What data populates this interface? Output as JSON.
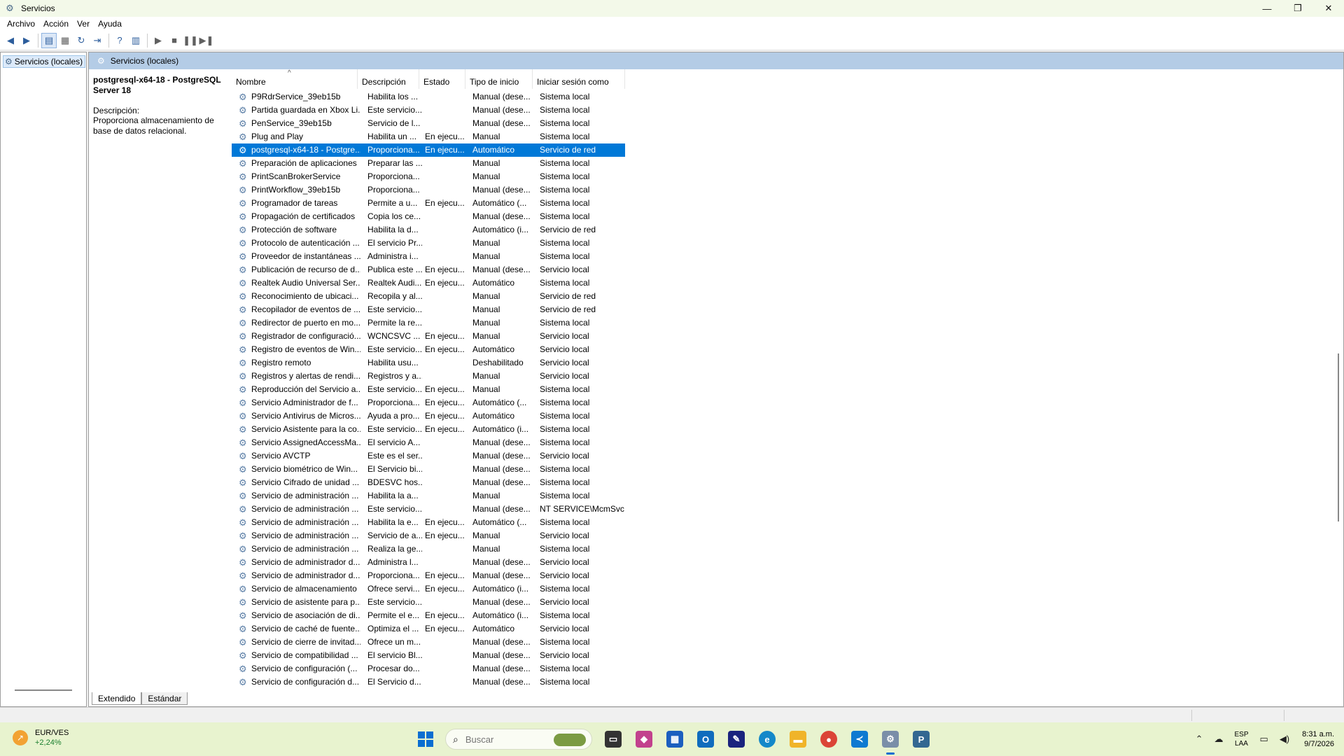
{
  "window": {
    "title": "Servicios",
    "minimize_icon": "—",
    "maximize_icon": "❐",
    "close_icon": "✕"
  },
  "menu": [
    "Archivo",
    "Acción",
    "Ver",
    "Ayuda"
  ],
  "tree": {
    "item": "Servicios (locales)"
  },
  "header": {
    "title": "Servicios (locales)"
  },
  "details": {
    "title": "postgresql-x64-18 - PostgreSQL Server 18",
    "label": "Descripción:",
    "text": "Proporciona almacenamiento de base de datos relacional."
  },
  "columns": {
    "name": "Nombre",
    "desc": "Descripción",
    "state": "Estado",
    "start": "Tipo de inicio",
    "logon": "Iniciar sesión como"
  },
  "rows": [
    {
      "name": "P9RdrService_39eb15b",
      "desc": "Habilita los ...",
      "state": "",
      "start": "Manual (dese...",
      "logon": "Sistema local"
    },
    {
      "name": "Partida guardada en Xbox Li...",
      "desc": "Este servicio...",
      "state": "",
      "start": "Manual (dese...",
      "logon": "Sistema local"
    },
    {
      "name": "PenService_39eb15b",
      "desc": "Servicio de l...",
      "state": "",
      "start": "Manual (dese...",
      "logon": "Sistema local"
    },
    {
      "name": "Plug and Play",
      "desc": "Habilita un ...",
      "state": "En ejecu...",
      "start": "Manual",
      "logon": "Sistema local"
    },
    {
      "name": "postgresql-x64-18 - Postgre...",
      "desc": "Proporciona...",
      "state": "En ejecu...",
      "start": "Automático",
      "logon": "Servicio de red",
      "selected": true
    },
    {
      "name": "Preparación de aplicaciones",
      "desc": "Preparar las ...",
      "state": "",
      "start": "Manual",
      "logon": "Sistema local"
    },
    {
      "name": "PrintScanBrokerService",
      "desc": "Proporciona...",
      "state": "",
      "start": "Manual",
      "logon": "Sistema local"
    },
    {
      "name": "PrintWorkflow_39eb15b",
      "desc": "Proporciona...",
      "state": "",
      "start": "Manual (dese...",
      "logon": "Sistema local"
    },
    {
      "name": "Programador de tareas",
      "desc": "Permite a u...",
      "state": "En ejecu...",
      "start": "Automático (...",
      "logon": "Sistema local"
    },
    {
      "name": "Propagación de certificados",
      "desc": "Copia los ce...",
      "state": "",
      "start": "Manual (dese...",
      "logon": "Sistema local"
    },
    {
      "name": "Protección de software",
      "desc": "Habilita la d...",
      "state": "",
      "start": "Automático (i...",
      "logon": "Servicio de red"
    },
    {
      "name": "Protocolo de autenticación ...",
      "desc": "El servicio Pr...",
      "state": "",
      "start": "Manual",
      "logon": "Sistema local"
    },
    {
      "name": "Proveedor de instantáneas ...",
      "desc": "Administra i...",
      "state": "",
      "start": "Manual",
      "logon": "Sistema local"
    },
    {
      "name": "Publicación de recurso de d...",
      "desc": "Publica este ...",
      "state": "En ejecu...",
      "start": "Manual (dese...",
      "logon": "Servicio local"
    },
    {
      "name": "Realtek Audio Universal Ser...",
      "desc": "Realtek Audi...",
      "state": "En ejecu...",
      "start": "Automático",
      "logon": "Sistema local"
    },
    {
      "name": "Reconocimiento de ubicaci...",
      "desc": "Recopila y al...",
      "state": "",
      "start": "Manual",
      "logon": "Servicio de red"
    },
    {
      "name": "Recopilador de eventos de ...",
      "desc": "Este servicio...",
      "state": "",
      "start": "Manual",
      "logon": "Servicio de red"
    },
    {
      "name": "Redirector de puerto en mo...",
      "desc": "Permite la re...",
      "state": "",
      "start": "Manual",
      "logon": "Sistema local"
    },
    {
      "name": "Registrador de configuració...",
      "desc": "WCNCSVC ...",
      "state": "En ejecu...",
      "start": "Manual",
      "logon": "Servicio local"
    },
    {
      "name": "Registro de eventos de Win...",
      "desc": "Este servicio...",
      "state": "En ejecu...",
      "start": "Automático",
      "logon": "Servicio local"
    },
    {
      "name": "Registro remoto",
      "desc": "Habilita usu...",
      "state": "",
      "start": "Deshabilitado",
      "logon": "Servicio local"
    },
    {
      "name": "Registros y alertas de rendi...",
      "desc": "Registros y a...",
      "state": "",
      "start": "Manual",
      "logon": "Servicio local"
    },
    {
      "name": "Reproducción del Servicio a...",
      "desc": "Este servicio...",
      "state": "En ejecu...",
      "start": "Manual",
      "logon": "Sistema local"
    },
    {
      "name": "Servicio Administrador de f...",
      "desc": "Proporciona...",
      "state": "En ejecu...",
      "start": "Automático (...",
      "logon": "Sistema local"
    },
    {
      "name": "Servicio Antivirus de Micros...",
      "desc": "Ayuda a pro...",
      "state": "En ejecu...",
      "start": "Automático",
      "logon": "Sistema local"
    },
    {
      "name": "Servicio Asistente para la co...",
      "desc": "Este servicio...",
      "state": "En ejecu...",
      "start": "Automático (i...",
      "logon": "Sistema local"
    },
    {
      "name": "Servicio AssignedAccessMa...",
      "desc": "El servicio A...",
      "state": "",
      "start": "Manual (dese...",
      "logon": "Sistema local"
    },
    {
      "name": "Servicio AVCTP",
      "desc": "Este es el ser...",
      "state": "",
      "start": "Manual (dese...",
      "logon": "Servicio local"
    },
    {
      "name": "Servicio biométrico de Win...",
      "desc": "El Servicio bi...",
      "state": "",
      "start": "Manual (dese...",
      "logon": "Sistema local"
    },
    {
      "name": "Servicio Cifrado de unidad ...",
      "desc": "BDESVC hos...",
      "state": "",
      "start": "Manual (dese...",
      "logon": "Sistema local"
    },
    {
      "name": "Servicio de administración ...",
      "desc": "Habilita la a...",
      "state": "",
      "start": "Manual",
      "logon": "Sistema local"
    },
    {
      "name": "Servicio de administración ...",
      "desc": "Este servicio...",
      "state": "",
      "start": "Manual (dese...",
      "logon": "NT SERVICE\\McmSvc"
    },
    {
      "name": "Servicio de administración ...",
      "desc": "Habilita la e...",
      "state": "En ejecu...",
      "start": "Automático (...",
      "logon": "Sistema local"
    },
    {
      "name": "Servicio de administración ...",
      "desc": "Servicio de a...",
      "state": "En ejecu...",
      "start": "Manual",
      "logon": "Servicio local"
    },
    {
      "name": "Servicio de administración ...",
      "desc": "Realiza la ge...",
      "state": "",
      "start": "Manual",
      "logon": "Sistema local"
    },
    {
      "name": "Servicio de administrador d...",
      "desc": "Administra l...",
      "state": "",
      "start": "Manual (dese...",
      "logon": "Servicio local"
    },
    {
      "name": "Servicio de administrador d...",
      "desc": "Proporciona...",
      "state": "En ejecu...",
      "start": "Manual (dese...",
      "logon": "Servicio local"
    },
    {
      "name": "Servicio de almacenamiento",
      "desc": "Ofrece servi...",
      "state": "En ejecu...",
      "start": "Automático (i...",
      "logon": "Sistema local"
    },
    {
      "name": "Servicio de asistente para p...",
      "desc": "Este servicio...",
      "state": "",
      "start": "Manual (dese...",
      "logon": "Servicio local"
    },
    {
      "name": "Servicio de asociación de di...",
      "desc": "Permite el e...",
      "state": "En ejecu...",
      "start": "Automático (i...",
      "logon": "Sistema local"
    },
    {
      "name": "Servicio de caché de fuente...",
      "desc": "Optimiza el ...",
      "state": "En ejecu...",
      "start": "Automático",
      "logon": "Servicio local"
    },
    {
      "name": "Servicio de cierre de invitad...",
      "desc": "Ofrece un m...",
      "state": "",
      "start": "Manual (dese...",
      "logon": "Sistema local"
    },
    {
      "name": "Servicio de compatibilidad ...",
      "desc": "El servicio Bl...",
      "state": "",
      "start": "Manual (dese...",
      "logon": "Servicio local"
    },
    {
      "name": "Servicio de configuración (...",
      "desc": "Procesar do...",
      "state": "",
      "start": "Manual (dese...",
      "logon": "Sistema local"
    },
    {
      "name": "Servicio de configuración d...",
      "desc": "El Servicio d...",
      "state": "",
      "start": "Manual (dese...",
      "logon": "Sistema local"
    }
  ],
  "tabs": [
    "Extendido",
    "Estándar"
  ],
  "taskbar": {
    "weather_title": "EUR/VES",
    "weather_change": "+2,24%",
    "search_placeholder": "Buscar",
    "lang_1": "ESP",
    "lang_2": "LAA",
    "time": "8:31 a.m.",
    "date": "9/7/2026"
  },
  "colors": {
    "selection": "#0078d7",
    "header_band": "#b4cce6",
    "taskbar": "#e8f3cf"
  }
}
